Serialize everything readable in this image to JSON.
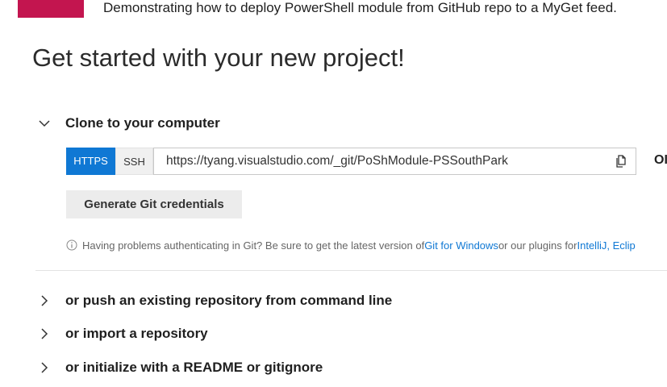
{
  "project": {
    "description": "Demonstrating how to deploy PowerShell module from GitHub repo to a MyGet feed.",
    "avatar_color": "#c3154f"
  },
  "page": {
    "title": "Get started with your new project!"
  },
  "clone": {
    "header_label": "Clone to your computer",
    "https_label": "HTTPS",
    "ssh_label": "SSH",
    "url": "https://tyang.visualstudio.com/_git/PoShModule-PSSouthPark",
    "copy_icon": "copy-icon",
    "or_text": "OI",
    "generate_label": "Generate Git credentials",
    "help_prefix": "Having problems authenticating in Git? Be sure to get the latest version of ",
    "help_link1": "Git for Windows",
    "help_middle": " or our plugins for ",
    "help_link2": "IntelliJ, Eclip",
    "accent_color": "#0f78d4"
  },
  "sections": {
    "push_label": "or push an existing repository from command line",
    "import_label": "or import a repository",
    "init_label": "or initialize with a README or gitignore"
  }
}
